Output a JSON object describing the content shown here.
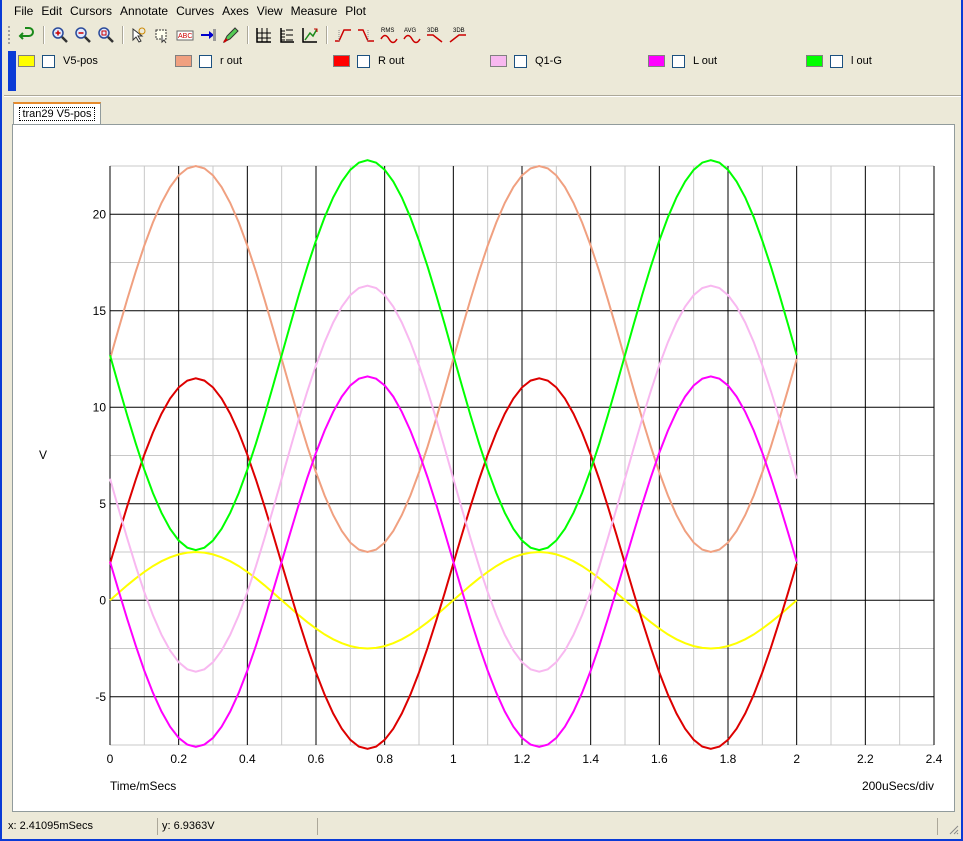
{
  "menubar": {
    "items": [
      "File",
      "Edit",
      "Cursors",
      "Annotate",
      "Curves",
      "Axes",
      "View",
      "Measure",
      "Plot"
    ]
  },
  "toolbar": {
    "icons": [
      "undo-icon",
      "zoom-in-icon",
      "zoom-out-icon",
      "zoom-fit-icon",
      "cursor-icon",
      "select-icon",
      "text-annotate-icon",
      "arrow-icon",
      "pen-icon",
      "grid-major-icon",
      "grid-minor-icon",
      "auto-scale-icon",
      "rise-time-icon",
      "fall-time-icon",
      "rms-icon",
      "avg-icon",
      "3db-high-icon",
      "3db-low-icon"
    ],
    "rms_label": "RMS",
    "avg_label": "AVG",
    "db3_label": "3DB",
    "db3b_label": "3DB"
  },
  "legend": [
    {
      "label": "V5-pos",
      "color": "#ffff00"
    },
    {
      "label": "r out",
      "color": "#f0a080"
    },
    {
      "label": "R out",
      "color": "#ff0000"
    },
    {
      "label": "Q1-G",
      "color": "#f8b8f0"
    },
    {
      "label": "L out",
      "color": "#ff00ff"
    },
    {
      "label": "l out",
      "color": "#00ff00"
    }
  ],
  "tab": {
    "label": "tran29 V5-pos"
  },
  "chart_data": {
    "type": "line",
    "xlabel": "Time/mSecs",
    "ylabel": "V",
    "scale_note": "200uSecs/div",
    "xlim": [
      0,
      2.4
    ],
    "ylim": [
      -7.5,
      22.5
    ],
    "x_ticks": [
      "0",
      "0.2",
      "0.4",
      "0.6",
      "0.8",
      "1",
      "1.2",
      "1.4",
      "1.6",
      "1.8",
      "2",
      "2.2",
      "2.4"
    ],
    "y_ticks": [
      "-5",
      "0",
      "5",
      "10",
      "15",
      "20"
    ],
    "grid": true,
    "period_ms": 1.0,
    "x_end": 2.0,
    "series": [
      {
        "name": "V5-pos",
        "color": "#ffff00",
        "offset": 0,
        "amplitude": 2.5,
        "phase_deg": 0
      },
      {
        "name": "r out",
        "color": "#f0a080",
        "offset": 12.5,
        "amplitude": 10,
        "phase_deg": 0
      },
      {
        "name": "R out",
        "color": "#dd0000",
        "offset": 1.9,
        "amplitude": 9.6,
        "phase_deg": 0
      },
      {
        "name": "Q1-G",
        "color": "#f8b8f0",
        "offset": 6.3,
        "amplitude": 10,
        "phase_deg": 180
      },
      {
        "name": "L out",
        "color": "#ff00ff",
        "offset": 2.0,
        "amplitude": 9.6,
        "phase_deg": 180
      },
      {
        "name": "l out",
        "color": "#00ff00",
        "offset": 12.7,
        "amplitude": 10.1,
        "phase_deg": 180
      }
    ]
  },
  "status": {
    "x_readout": "x: 2.41095mSecs",
    "y_readout": "y: 6.9363V"
  }
}
